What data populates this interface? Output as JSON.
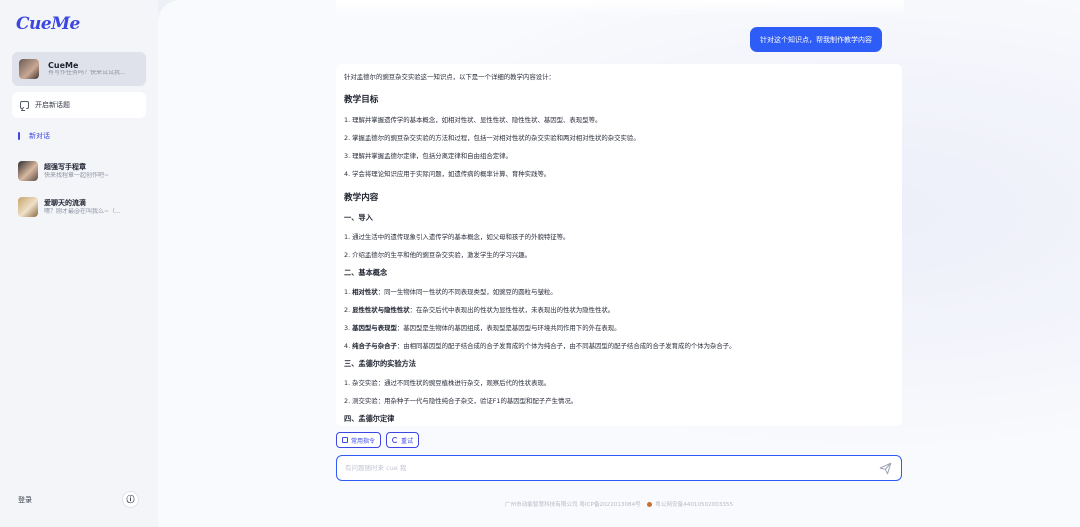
{
  "app": {
    "logo": "CueMe"
  },
  "sidebar": {
    "agent": {
      "name": "CueMe",
      "subtitle": "有写作任务吗？快来试试我..."
    },
    "new_topic_label": "开启新话题",
    "current_label": "新对话",
    "conversations": [
      {
        "title": "超强写手程章",
        "subtitle": "快来找程章一起创作吧~"
      },
      {
        "title": "爱聊天的流滴",
        "subtitle": "嘿？刚才最@在叫我么~（..."
      }
    ],
    "login_label": "登录",
    "info_icon": "ⓘ"
  },
  "chat": {
    "user_message": "针对这个知识点，帮我制作教学内容",
    "answer": {
      "intro": "针对孟德尔的豌豆杂交实验这一知识点，以下是一个详细的教学内容设计：",
      "h_goals": "教学目标",
      "goals": [
        "1. 理解并掌握遗传学的基本概念，如相对性状、显性性状、隐性性状、基因型、表现型等。",
        "2. 掌握孟德尔的豌豆杂交实验的方法和过程，包括一对相对性状的杂交实验和两对相对性状的杂交实验。",
        "3. 理解并掌握孟德尔定律，包括分离定律和自由组合定律。",
        "4. 学会将理论知识应用于实际问题，如遗传病的概率计算、育种实践等。"
      ],
      "h_content": "教学内容",
      "s1": "一、导入",
      "s1_items": [
        "1. 通过生活中的遗传现象引入遗传学的基本概念，如父母和孩子的外貌特征等。",
        "2. 介绍孟德尔的生平和他的豌豆杂交实验，激发学生的学习兴趣。"
      ],
      "s2": "二、基本概念",
      "s2_items": [
        {
          "num": "1. ",
          "term": "相对性状",
          "text": "：同一生物体同一性状的不同表现类型，如豌豆的圆粒与皱粒。"
        },
        {
          "num": "2. ",
          "term": "显性性状与隐性性状",
          "text": "：在杂交后代中表现出的性状为显性性状，未表现出的性状为隐性性状。"
        },
        {
          "num": "3. ",
          "term": "基因型与表现型",
          "text": "：基因型是生物体的基因组成，表现型是基因型与环境共同作用下的外在表现。"
        },
        {
          "num": "4. ",
          "term": "纯合子与杂合子",
          "text": "：由相同基因型的配子结合成的合子发育成的个体为纯合子，由不同基因型的配子结合成的合子发育成的个体为杂合子。"
        }
      ],
      "s3": "三、孟德尔的实验方法",
      "s3_items": [
        "1. 杂交实验：通过不同性状的豌豆植株进行杂交，观察后代的性状表现。",
        "2. 测交实验：用杂种子一代与隐性纯合子杂交，验证F1的基因型和配子产生情况。"
      ],
      "s4": "四、孟德尔定律"
    },
    "chips": [
      "常用指令",
      "重试"
    ],
    "input_placeholder": "有问题随时来 cue 我",
    "footer_company": "广州市动能智慧科技有限公司 粤ICP备2022013084号",
    "footer_police": "粤公网安备44010502003355"
  },
  "colors": {
    "accent": "#2e5cf6",
    "brand": "#3b47e0"
  }
}
